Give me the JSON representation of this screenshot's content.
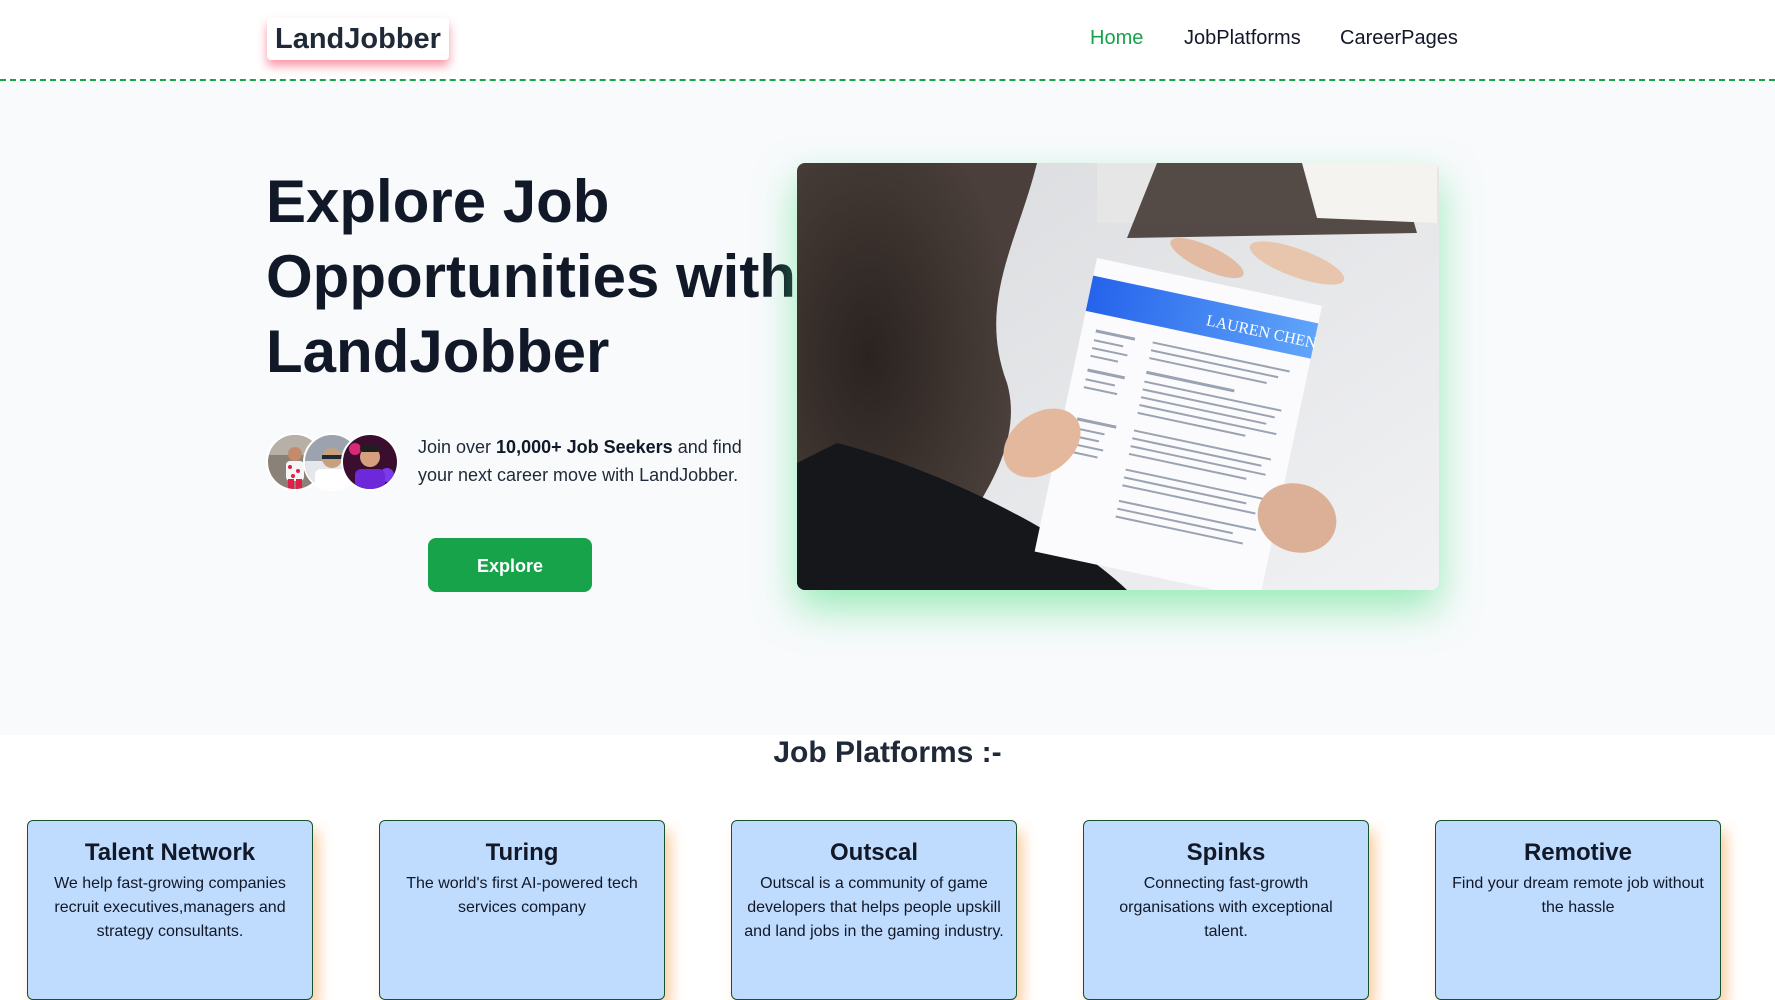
{
  "header": {
    "logo": "LandJobber",
    "nav": [
      {
        "label": "Home",
        "active": true
      },
      {
        "label": "JobPlatforms",
        "active": false
      },
      {
        "label": "CareerPages",
        "active": false
      }
    ]
  },
  "hero": {
    "title": "Explore Job Opportunities with LandJobber",
    "seekers_prefix": "Join over ",
    "seekers_bold": "10,000+ Job Seekers",
    "seekers_suffix": " and find your next career move with LandJobber.",
    "explore_label": "Explore",
    "resume_name": "LAUREN CHEN"
  },
  "platforms": {
    "title": "Job Platforms :-",
    "cards": [
      {
        "name": "Talent Network",
        "desc": "We help fast-growing companies recruit executives,managers and strategy consultants."
      },
      {
        "name": "Turing",
        "desc": "The world's first AI-powered tech services company"
      },
      {
        "name": "Outscal",
        "desc": "Outscal is a community of game developers that helps people upskill and land jobs in the gaming industry."
      },
      {
        "name": "Spinks",
        "desc": "Connecting fast-growth organisations with exceptional talent."
      },
      {
        "name": "Remotive",
        "desc": "Find your dream remote job without the hassle"
      }
    ]
  },
  "colors": {
    "accent": "#16a34a",
    "card_bg": "#bfdbfe",
    "hero_bg": "#f8fafc",
    "text": "#111827"
  }
}
